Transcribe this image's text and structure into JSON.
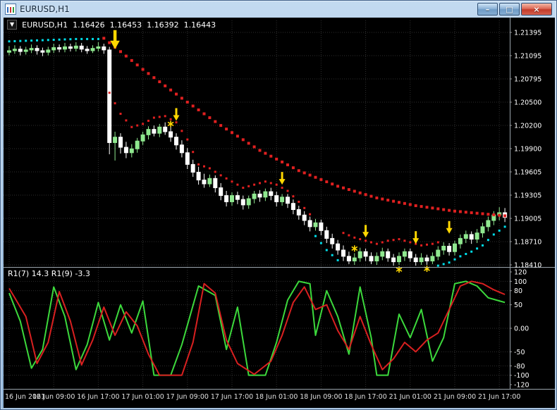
{
  "window": {
    "title": "EURUSD,H1",
    "controls": {
      "minimize": "–",
      "restore": "□",
      "close": "×"
    }
  },
  "chart": {
    "symbol_line": {
      "expand_arrow": "▼",
      "symbol": "EURUSD,H1",
      "open": "1.16426",
      "high": "1.16453",
      "low": "1.16392",
      "close": "1.16443"
    },
    "indicator_label": "R1(7) 14.3  R1(9) -3.3",
    "price_axis": [
      "1.21395",
      "1.21095",
      "1.20795",
      "1.20500",
      "1.20200",
      "1.19900",
      "1.19605",
      "1.19305",
      "1.19005",
      "1.18710",
      "1.18410"
    ],
    "indicator_axis": [
      "120",
      "100",
      "80",
      "50",
      "0.00",
      "-50",
      "-80",
      "-100",
      "-120"
    ],
    "time_axis": [
      "16 Jun 2021",
      "16 Jun 09:00",
      "16 Jun 17:00",
      "17 Jun 01:00",
      "17 Jun 09:00",
      "17 Jun 17:00",
      "18 Jun 01:00",
      "18 Jun 09:00",
      "18 Jun 17:00",
      "21 Jun 01:00",
      "21 Jun 09:00",
      "21 Jun 17:00"
    ]
  },
  "chart_data": {
    "type": "candlestick",
    "symbol": "EURUSD",
    "timeframe": "H1",
    "price_gridlines": [
      1.21395,
      1.21095,
      1.20795,
      1.205,
      1.202,
      1.199,
      1.19605,
      1.19305,
      1.19005,
      1.1871,
      1.1841
    ],
    "candles": [
      [
        1.2114,
        1.2122,
        1.211,
        1.2116
      ],
      [
        1.2116,
        1.2123,
        1.2112,
        1.2118
      ],
      [
        1.2118,
        1.2122,
        1.211,
        1.2115
      ],
      [
        1.2115,
        1.2121,
        1.2111,
        1.2117
      ],
      [
        1.2117,
        1.2124,
        1.2113,
        1.2119
      ],
      [
        1.2119,
        1.2123,
        1.2111,
        1.2116
      ],
      [
        1.2116,
        1.212,
        1.2109,
        1.2114
      ],
      [
        1.2114,
        1.2121,
        1.211,
        1.2117
      ],
      [
        1.2117,
        1.2125,
        1.2113,
        1.212
      ],
      [
        1.212,
        1.2124,
        1.2114,
        1.2118
      ],
      [
        1.2118,
        1.2126,
        1.2114,
        1.2121
      ],
      [
        1.2121,
        1.2125,
        1.2115,
        1.2119
      ],
      [
        1.2119,
        1.2127,
        1.2115,
        1.2122
      ],
      [
        1.2122,
        1.2126,
        1.2114,
        1.2118
      ],
      [
        1.2118,
        1.2122,
        1.2112,
        1.2116
      ],
      [
        1.2116,
        1.2123,
        1.2113,
        1.2119
      ],
      [
        1.2119,
        1.2127,
        1.2115,
        1.2121
      ],
      [
        1.2121,
        1.2125,
        1.2112,
        1.2117
      ],
      [
        1.2117,
        1.2121,
        1.1983,
        1.1998
      ],
      [
        1.1998,
        1.2012,
        1.1975,
        1.2005
      ],
      [
        1.2005,
        1.201,
        1.1984,
        1.1992
      ],
      [
        1.1992,
        1.1999,
        1.1978,
        1.1985
      ],
      [
        1.1985,
        1.1996,
        1.1979,
        1.199
      ],
      [
        1.199,
        1.2004,
        1.1985,
        1.2
      ],
      [
        1.2,
        1.2012,
        1.1995,
        1.2008
      ],
      [
        1.2008,
        1.2019,
        1.2002,
        1.2015
      ],
      [
        1.2015,
        1.202,
        1.2006,
        1.201
      ],
      [
        1.201,
        1.2022,
        1.2005,
        1.2018
      ],
      [
        1.2018,
        1.2024,
        1.2008,
        1.2012
      ],
      [
        1.2012,
        1.2018,
        1.1999,
        1.2005
      ],
      [
        1.2005,
        1.201,
        1.1989,
        1.1995
      ],
      [
        1.1995,
        1.2001,
        1.1979,
        1.1985
      ],
      [
        1.1985,
        1.1991,
        1.1964,
        1.197
      ],
      [
        1.197,
        1.1976,
        1.1954,
        1.196
      ],
      [
        1.196,
        1.1967,
        1.1944,
        1.195
      ],
      [
        1.195,
        1.1958,
        1.194,
        1.1945
      ],
      [
        1.1945,
        1.1957,
        1.1941,
        1.1952
      ],
      [
        1.1952,
        1.1956,
        1.1934,
        1.194
      ],
      [
        1.194,
        1.1946,
        1.1924,
        1.193
      ],
      [
        1.193,
        1.1936,
        1.1916,
        1.1922
      ],
      [
        1.1922,
        1.1934,
        1.1917,
        1.193
      ],
      [
        1.193,
        1.1935,
        1.1919,
        1.1925
      ],
      [
        1.1925,
        1.193,
        1.1912,
        1.1918
      ],
      [
        1.1918,
        1.193,
        1.1913,
        1.1926
      ],
      [
        1.1926,
        1.1936,
        1.192,
        1.1932
      ],
      [
        1.1932,
        1.1937,
        1.1922,
        1.1928
      ],
      [
        1.1928,
        1.1939,
        1.1923,
        1.1935
      ],
      [
        1.1935,
        1.194,
        1.1924,
        1.193
      ],
      [
        1.193,
        1.1935,
        1.1916,
        1.1922
      ],
      [
        1.1922,
        1.1932,
        1.1917,
        1.1928
      ],
      [
        1.1928,
        1.1932,
        1.1914,
        1.192
      ],
      [
        1.192,
        1.1925,
        1.1906,
        1.1912
      ],
      [
        1.1912,
        1.1917,
        1.1899,
        1.1905
      ],
      [
        1.1905,
        1.191,
        1.1892,
        1.1898
      ],
      [
        1.1898,
        1.1903,
        1.1884,
        1.189
      ],
      [
        1.189,
        1.19,
        1.1885,
        1.1895
      ],
      [
        1.1895,
        1.1899,
        1.1879,
        1.1885
      ],
      [
        1.1885,
        1.189,
        1.1869,
        1.1875
      ],
      [
        1.1875,
        1.1881,
        1.1862,
        1.1868
      ],
      [
        1.1868,
        1.1873,
        1.1854,
        1.186
      ],
      [
        1.186,
        1.1866,
        1.1846,
        1.1852
      ],
      [
        1.1852,
        1.1858,
        1.1842,
        1.1846
      ],
      [
        1.1846,
        1.1856,
        1.1841,
        1.185
      ],
      [
        1.185,
        1.1863,
        1.1845,
        1.1858
      ],
      [
        1.1858,
        1.1862,
        1.1846,
        1.1852
      ],
      [
        1.1852,
        1.1857,
        1.1842,
        1.1846
      ],
      [
        1.1846,
        1.1857,
        1.1841,
        1.1852
      ],
      [
        1.1852,
        1.1863,
        1.1847,
        1.1858
      ],
      [
        1.1858,
        1.1862,
        1.1845,
        1.185
      ],
      [
        1.185,
        1.1855,
        1.184,
        1.1845
      ],
      [
        1.1845,
        1.1857,
        1.1841,
        1.1852
      ],
      [
        1.1852,
        1.1862,
        1.1846,
        1.1858
      ],
      [
        1.1858,
        1.1862,
        1.1845,
        1.185
      ],
      [
        1.185,
        1.1855,
        1.184,
        1.1845
      ],
      [
        1.1845,
        1.1856,
        1.1841,
        1.185
      ],
      [
        1.185,
        1.1854,
        1.1841,
        1.1846
      ],
      [
        1.1846,
        1.1857,
        1.1842,
        1.1852
      ],
      [
        1.1852,
        1.1865,
        1.1847,
        1.186
      ],
      [
        1.186,
        1.187,
        1.1854,
        1.1865
      ],
      [
        1.1865,
        1.1869,
        1.1853,
        1.1858
      ],
      [
        1.1858,
        1.1872,
        1.1853,
        1.1868
      ],
      [
        1.1868,
        1.188,
        1.1862,
        1.1875
      ],
      [
        1.1875,
        1.1885,
        1.1869,
        1.188
      ],
      [
        1.188,
        1.1884,
        1.1868,
        1.1874
      ],
      [
        1.1874,
        1.1887,
        1.1869,
        1.1882
      ],
      [
        1.1882,
        1.1895,
        1.1876,
        1.189
      ],
      [
        1.189,
        1.1903,
        1.1884,
        1.1898
      ],
      [
        1.1898,
        1.191,
        1.1892,
        1.1905
      ],
      [
        1.1905,
        1.1915,
        1.1898,
        1.1908
      ],
      [
        1.1908,
        1.1914,
        1.1896,
        1.1902
      ]
    ],
    "trails": [
      {
        "name": "upper-sell-trail",
        "color": "red",
        "dot": 4,
        "points": [
          [
            17,
            1.2132
          ],
          [
            24,
            1.2092
          ],
          [
            31,
            1.2055
          ],
          [
            38,
            1.202
          ],
          [
            45,
            1.1988
          ],
          [
            52,
            1.1962
          ],
          [
            59,
            1.1942
          ],
          [
            66,
            1.1927
          ],
          [
            73,
            1.1917
          ],
          [
            80,
            1.191
          ],
          [
            89,
            1.1904
          ]
        ]
      },
      {
        "name": "lower-sell-trail-1",
        "color": "red",
        "dot": 3,
        "points": [
          [
            18,
            1.2062
          ],
          [
            20,
            1.2035
          ],
          [
            22,
            1.2018
          ],
          [
            24,
            1.2022
          ],
          [
            26,
            1.203
          ],
          [
            28,
            1.2032
          ],
          [
            30,
            1.2024
          ],
          [
            32,
            1.2002
          ],
          [
            34,
            1.197
          ],
          [
            36,
            1.1965
          ],
          [
            38,
            1.1956
          ],
          [
            40,
            1.1948
          ],
          [
            42,
            1.194
          ],
          [
            44,
            1.1944
          ],
          [
            46,
            1.1948
          ],
          [
            48,
            1.1944
          ],
          [
            50,
            1.1936
          ],
          [
            52,
            1.1922
          ],
          [
            54,
            1.1906
          ]
        ]
      },
      {
        "name": "mid-buy-trail",
        "color": "cyan",
        "dot": 3,
        "points": [
          [
            55,
            1.1878
          ],
          [
            57,
            1.186
          ],
          [
            59,
            1.1847
          ]
        ]
      },
      {
        "name": "lower-sell-trail-2",
        "color": "red",
        "dot": 3,
        "points": [
          [
            60,
            1.1882
          ],
          [
            62,
            1.1876
          ],
          [
            64,
            1.1872
          ],
          [
            66,
            1.1868
          ],
          [
            68,
            1.1872
          ],
          [
            70,
            1.1874
          ],
          [
            72,
            1.187
          ],
          [
            74,
            1.1866
          ],
          [
            76,
            1.1868
          ],
          [
            77,
            1.187
          ]
        ]
      },
      {
        "name": "left-buy-trail",
        "color": "cyan",
        "dot": 3,
        "points": [
          [
            0,
            1.2128
          ],
          [
            4,
            1.2129
          ],
          [
            8,
            1.213
          ],
          [
            12,
            1.2131
          ],
          [
            16,
            1.2131
          ]
        ]
      },
      {
        "name": "right-buy-trail",
        "color": "cyan",
        "dot": 3,
        "points": [
          [
            77,
            1.184
          ],
          [
            79,
            1.1844
          ],
          [
            81,
            1.1852
          ],
          [
            83,
            1.1858
          ],
          [
            85,
            1.1866
          ],
          [
            87,
            1.188
          ],
          [
            89,
            1.189
          ]
        ]
      }
    ],
    "sell_arrows": [
      [
        19,
        1.2118,
        1.5
      ],
      [
        30,
        1.2026,
        1
      ],
      [
        49,
        1.1944,
        1
      ],
      [
        64,
        1.1876,
        1
      ],
      [
        73,
        1.1868,
        1
      ],
      [
        79,
        1.1881,
        1
      ]
    ],
    "stars": [
      [
        29,
        1.2022
      ],
      [
        62,
        1.1862
      ],
      [
        70,
        1.1835
      ],
      [
        75,
        1.1836
      ]
    ],
    "oscillator": {
      "axis_values": [
        120,
        100,
        80,
        50,
        0,
        -50,
        -80,
        -100,
        -120
      ],
      "levels": [
        100,
        80,
        50,
        0,
        -50,
        -80,
        -100
      ],
      "range": [
        -120,
        120
      ],
      "green_keypoints": [
        [
          0,
          75
        ],
        [
          2,
          15
        ],
        [
          4,
          -85
        ],
        [
          6,
          -45
        ],
        [
          8,
          88
        ],
        [
          10,
          25
        ],
        [
          12,
          -88
        ],
        [
          14,
          -35
        ],
        [
          16,
          55
        ],
        [
          18,
          -25
        ],
        [
          20,
          50
        ],
        [
          22,
          -10
        ],
        [
          24,
          58
        ],
        [
          26,
          -100
        ],
        [
          29,
          -100
        ],
        [
          31,
          -35
        ],
        [
          34,
          90
        ],
        [
          37,
          70
        ],
        [
          39,
          -45
        ],
        [
          41,
          45
        ],
        [
          43,
          -100
        ],
        [
          46,
          -100
        ],
        [
          48,
          -30
        ],
        [
          50,
          60
        ],
        [
          52,
          100
        ],
        [
          54,
          95
        ],
        [
          55,
          -15
        ],
        [
          57,
          80
        ],
        [
          59,
          25
        ],
        [
          61,
          -55
        ],
        [
          63,
          88
        ],
        [
          65,
          -20
        ],
        [
          66,
          -100
        ],
        [
          68,
          -100
        ],
        [
          70,
          30
        ],
        [
          72,
          -20
        ],
        [
          74,
          40
        ],
        [
          76,
          -70
        ],
        [
          78,
          -20
        ],
        [
          80,
          95
        ],
        [
          82,
          100
        ],
        [
          84,
          90
        ],
        [
          86,
          65
        ],
        [
          89,
          55
        ]
      ],
      "red_keypoints": [
        [
          0,
          85
        ],
        [
          3,
          25
        ],
        [
          5,
          -75
        ],
        [
          7,
          -30
        ],
        [
          9,
          78
        ],
        [
          11,
          15
        ],
        [
          13,
          -78
        ],
        [
          15,
          -25
        ],
        [
          17,
          45
        ],
        [
          19,
          -15
        ],
        [
          21,
          35
        ],
        [
          23,
          5
        ],
        [
          25,
          -55
        ],
        [
          27,
          -100
        ],
        [
          31,
          -100
        ],
        [
          33,
          -30
        ],
        [
          35,
          95
        ],
        [
          37,
          75
        ],
        [
          39,
          -25
        ],
        [
          41,
          -75
        ],
        [
          44,
          -98
        ],
        [
          47,
          -70
        ],
        [
          49,
          -15
        ],
        [
          51,
          55
        ],
        [
          53,
          88
        ],
        [
          55,
          40
        ],
        [
          57,
          50
        ],
        [
          59,
          -5
        ],
        [
          61,
          -45
        ],
        [
          63,
          25
        ],
        [
          65,
          -35
        ],
        [
          67,
          -88
        ],
        [
          69,
          -65
        ],
        [
          71,
          -30
        ],
        [
          73,
          -50
        ],
        [
          75,
          -25
        ],
        [
          77,
          -10
        ],
        [
          79,
          40
        ],
        [
          81,
          90
        ],
        [
          83,
          100
        ],
        [
          85,
          95
        ],
        [
          87,
          82
        ],
        [
          89,
          72
        ]
      ]
    },
    "colors": {
      "background": "#000000",
      "grid": "#2e2e2e",
      "bull": "#8fe88f",
      "bear": "#ffffff",
      "trail_red": "#e02020",
      "trail_cyan": "#00dde8",
      "signal_yellow": "#ffd700",
      "osc_green": "#3cd93c",
      "osc_red": "#d92020",
      "axis_text": "#ffffff",
      "separator": "#9aa4ad"
    }
  }
}
